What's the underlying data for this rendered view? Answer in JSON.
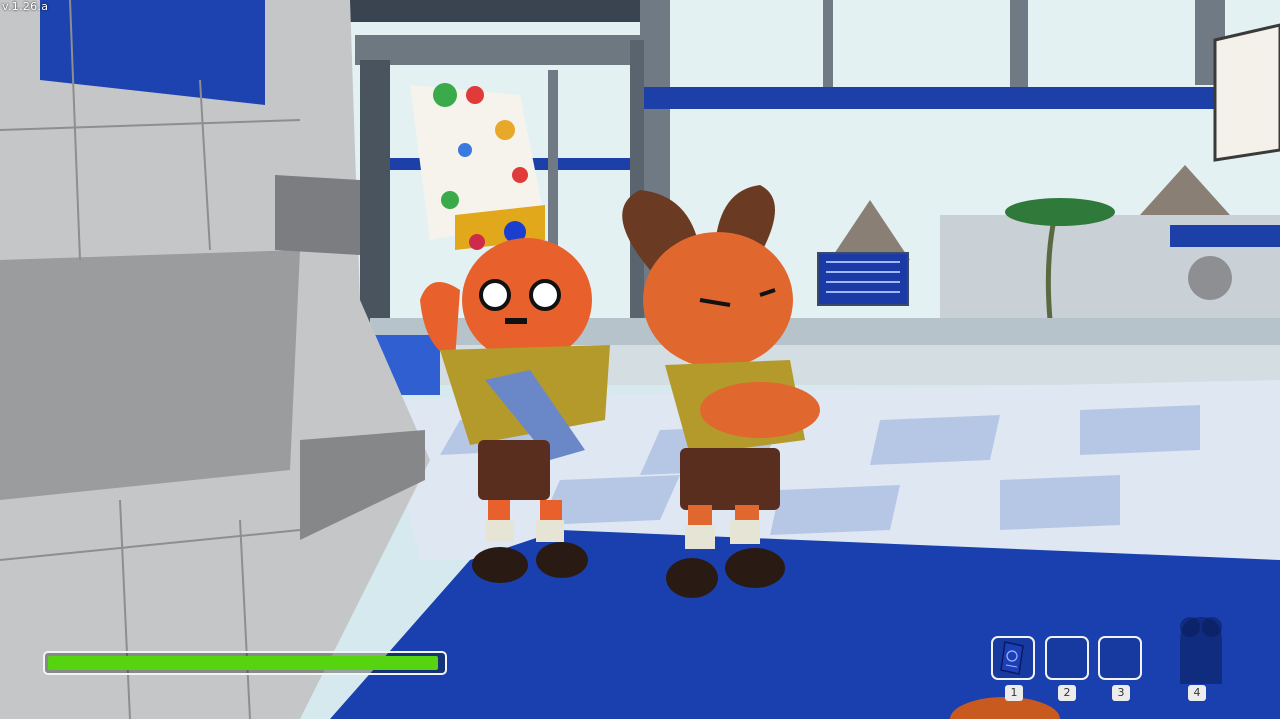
{
  "version": "v.1.26.a",
  "health": {
    "fraction": 0.99,
    "color": "#56d40f"
  },
  "inventory": {
    "slots": [
      {
        "key": "1",
        "item": "passport-icon"
      },
      {
        "key": "2",
        "item": ""
      },
      {
        "key": "3",
        "item": ""
      },
      {
        "key": "4",
        "item": "locked-slot-icon"
      }
    ]
  },
  "colors": {
    "floor_blue": "#1a3fae",
    "sky": "#dbeef2",
    "character_orange": "#e8612c"
  }
}
